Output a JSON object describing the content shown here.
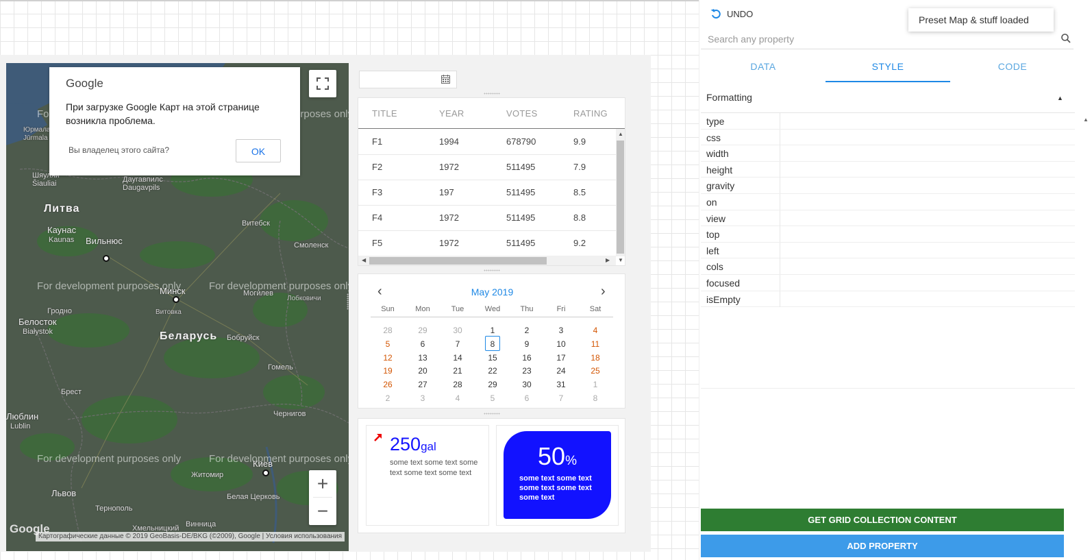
{
  "map": {
    "dialog_logo": "Google",
    "dialog_message": "При загрузке Google Карт на этой странице возникла проблема.",
    "dialog_owner": "Вы владелец этого сайта?",
    "dialog_ok": "OK",
    "dev_watermark": "For development purposes only",
    "brand": "Google",
    "attribution": "Картографические данные © 2019 GeoBasis-DE/BKG (©2009), Google  |  Условия использования",
    "labels": {
      "litva": "Литва",
      "belarus": "Беларусь",
      "kaunas": "Каунас",
      "kaunas_lat": "Kaunas",
      "vilnius": "Вильнюс",
      "minsk": "Минск",
      "belostok": "Белосток",
      "bialystok": "Białystok",
      "grodno": "Гродно",
      "vitebsk": "Витебск",
      "smolensk": "Смоленск",
      "mogilev": "Могилев",
      "bobruisk": "Бобруйск",
      "gomel": "Гомель",
      "brest": "Брест",
      "lublin": "Люблин",
      "lublin_lat": "Lublin",
      "chernigov": "Чернигов",
      "kiev": "Киев",
      "zhitomir": "Житомир",
      "lvov": "Львов",
      "ternopol": "Тернополь",
      "bila_tserkva": "Белая Церковь",
      "vinnitsa": "Винница",
      "khmelnitsky": "Хмельницкий",
      "daugavpils": "Даугавпилс",
      "daugavpils_lat": "Daugavpils",
      "shiauliai": "Шяуляй",
      "shiauliai_lat": "Šiauliai",
      "yurmala": "Юрмала",
      "yurmala_lat": "Jūrmala",
      "lobkovichi": "Лобковичи",
      "vitovka": "Витовка"
    }
  },
  "table": {
    "headers": [
      "TITLE",
      "YEAR",
      "VOTES",
      "RATING"
    ],
    "rows": [
      [
        "F1",
        "1994",
        "678790",
        "9.9"
      ],
      [
        "F2",
        "1972",
        "511495",
        "7.9"
      ],
      [
        "F3",
        "197",
        "511495",
        "8.5"
      ],
      [
        "F4",
        "1972",
        "511495",
        "8.8"
      ],
      [
        "F5",
        "1972",
        "511495",
        "9.2"
      ]
    ]
  },
  "calendar": {
    "month_label": "May 2019",
    "prev": "‹",
    "next": "›",
    "day_names": [
      "Sun",
      "Mon",
      "Tue",
      "Wed",
      "Thu",
      "Fri",
      "Sat"
    ],
    "weeks": [
      [
        "28",
        "29",
        "30",
        "1",
        "2",
        "3",
        "4"
      ],
      [
        "5",
        "6",
        "7",
        "8",
        "9",
        "10",
        "11"
      ],
      [
        "12",
        "13",
        "14",
        "15",
        "16",
        "17",
        "18"
      ],
      [
        "19",
        "20",
        "21",
        "22",
        "23",
        "24",
        "25"
      ],
      [
        "26",
        "27",
        "28",
        "29",
        "30",
        "31",
        "1"
      ],
      [
        "2",
        "3",
        "4",
        "5",
        "6",
        "7",
        "8"
      ]
    ],
    "selected": "8"
  },
  "widget1": {
    "value": "250",
    "unit": "gal",
    "text": "some text some text some text some text some text"
  },
  "widget2": {
    "value": "50",
    "unit": "%",
    "text": "some text some text some text some text some text"
  },
  "right": {
    "undo_label": "UNDO",
    "toast": "Preset Map & stuff loaded",
    "search_placeholder": "Search any property",
    "tabs": [
      "DATA",
      "STYLE",
      "CODE"
    ],
    "active_tab": "STYLE",
    "section_label": "Formatting",
    "properties": [
      "type",
      "css",
      "width",
      "height",
      "gravity",
      "on",
      "view",
      "top",
      "left",
      "cols",
      "focused",
      "isEmpty"
    ],
    "btn_green": "GET GRID COLLECTION CONTENT",
    "btn_blue": "ADD PROPERTY"
  },
  "colors": {
    "accent": "#1e88e5",
    "weekend": "#d35400",
    "widget_blue": "#1212ff",
    "green_button": "#2e7d32",
    "blue_button": "#3d9be9"
  }
}
